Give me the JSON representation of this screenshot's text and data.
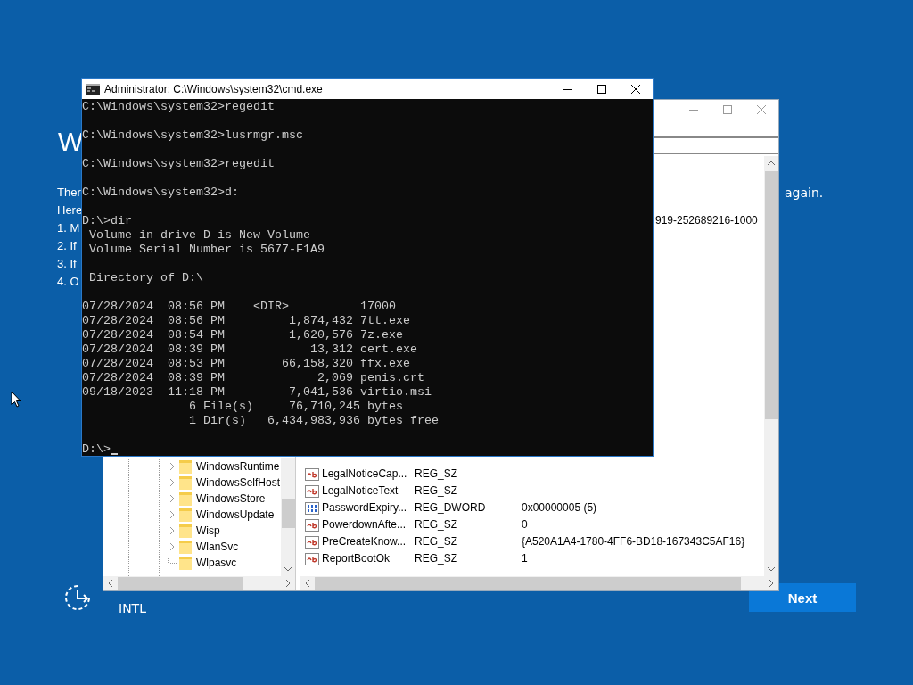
{
  "setup": {
    "heading": "W",
    "fragments": [
      "Ther",
      "Here",
      "1. M",
      "2. If",
      "3. If",
      "4. O"
    ],
    "trailing": "again.",
    "language": "INTL",
    "next_button": "Next"
  },
  "regedit": {
    "partial_value": "919-252689216-1000",
    "tree": [
      {
        "label": "WindowsRuntime",
        "expandable": true
      },
      {
        "label": "WindowsSelfHost",
        "expandable": true
      },
      {
        "label": "WindowsStore",
        "expandable": true
      },
      {
        "label": "WindowsUpdate",
        "expandable": true
      },
      {
        "label": "Wisp",
        "expandable": true
      },
      {
        "label": "WlanSvc",
        "expandable": true
      },
      {
        "label": "Wlpasvc",
        "expandable": false
      }
    ],
    "values": [
      {
        "name": "LegalNoticeCap...",
        "type": "REG_SZ",
        "kind": "string"
      },
      {
        "name": "LegalNoticeText",
        "type": "REG_SZ",
        "kind": "string"
      },
      {
        "name": "PasswordExpiry...",
        "type": "REG_DWORD",
        "kind": "dword",
        "data": "0x00000005 (5)"
      },
      {
        "name": "PowerdownAfte...",
        "type": "REG_SZ",
        "kind": "string",
        "data": "0"
      },
      {
        "name": "PreCreateKnow...",
        "type": "REG_SZ",
        "kind": "string",
        "data": "{A520A1A4-1780-4FF6-BD18-167343C5AF16}"
      },
      {
        "name": "ReportBootOk",
        "type": "REG_SZ",
        "kind": "string",
        "data": "1"
      }
    ]
  },
  "cmd": {
    "title": "Administrator: C:\\Windows\\system32\\cmd.exe",
    "blocks": [
      [
        "C:\\Windows\\system32>regedit"
      ],
      [
        "C:\\Windows\\system32>lusrmgr.msc"
      ],
      [
        "C:\\Windows\\system32>regedit"
      ],
      [
        "C:\\Windows\\system32>d:"
      ],
      [
        "D:\\>dir",
        " Volume in drive D is New Volume",
        " Volume Serial Number is 5677-F1A9"
      ],
      [
        " Directory of D:\\"
      ],
      [
        "07/28/2024  08:56 PM    <DIR>          17000",
        "07/28/2024  08:56 PM         1,874,432 7tt.exe",
        "07/28/2024  08:54 PM         1,620,576 7z.exe",
        "07/28/2024  08:39 PM            13,312 cert.exe",
        "07/28/2024  08:53 PM        66,158,320 ffx.exe",
        "07/28/2024  08:39 PM             2,069 penis.crt",
        "09/18/2023  11:18 PM         7,041,536 virtio.msi",
        "               6 File(s)     76,710,245 bytes",
        "               1 Dir(s)   6,434,983,936 bytes free"
      ],
      [
        "D:\\>"
      ]
    ]
  }
}
